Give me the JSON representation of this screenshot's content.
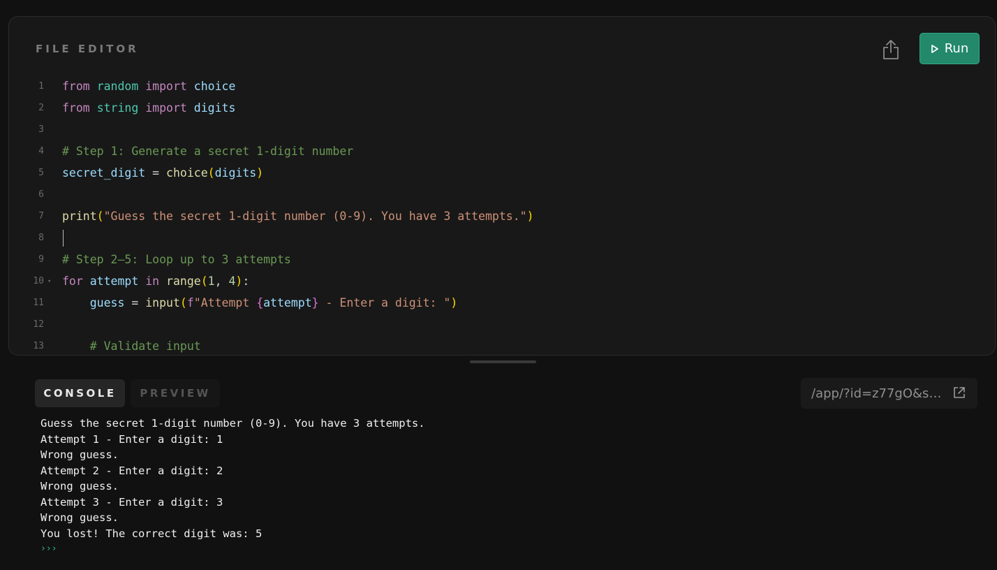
{
  "editor": {
    "title": "FILE EDITOR",
    "run_label": "Run",
    "lines": [
      {
        "n": "1"
      },
      {
        "n": "2"
      },
      {
        "n": "3"
      },
      {
        "n": "4"
      },
      {
        "n": "5"
      },
      {
        "n": "6"
      },
      {
        "n": "7"
      },
      {
        "n": "8"
      },
      {
        "n": "9"
      },
      {
        "n": "10"
      },
      {
        "n": "11"
      },
      {
        "n": "12"
      },
      {
        "n": "13"
      }
    ],
    "code": {
      "l1": {
        "kw1": "from",
        "mod": "random",
        "kw2": "import",
        "name": "choice"
      },
      "l2": {
        "kw1": "from",
        "mod": "string",
        "kw2": "import",
        "name": "digits"
      },
      "l4": {
        "comment": "# Step 1: Generate a secret 1-digit number"
      },
      "l5": {
        "var": "secret_digit",
        "eq": " = ",
        "fn": "choice",
        "open": "(",
        "arg": "digits",
        "close": ")"
      },
      "l7": {
        "fn": "print",
        "open": "(",
        "str": "\"Guess the secret 1-digit number (0-9). You have 3 attempts.\"",
        "close": ")"
      },
      "l9": {
        "comment": "# Step 2–5: Loop up to 3 attempts"
      },
      "l10": {
        "kw1": "for",
        "var": "attempt",
        "kw2": "in",
        "fn": "range",
        "open": "(",
        "n1": "1",
        "sep": ", ",
        "n2": "4",
        "close": ")",
        "colon": ":"
      },
      "l11": {
        "var": "guess",
        "eq": " = ",
        "fn": "input",
        "open": "(",
        "f": "f",
        "str1": "\"Attempt ",
        "lb": "{",
        "var2": "attempt",
        "rb": "}",
        "str2": " - Enter a digit: \"",
        "close": ")"
      },
      "l13": {
        "comment": "# Validate input"
      }
    }
  },
  "tabs": {
    "console": "CONSOLE",
    "preview": "PREVIEW"
  },
  "url": "/app/?id=z77gO&so...",
  "console": {
    "lines": [
      "Guess the secret 1-digit number (0-9). You have 3 attempts.",
      "Attempt 1 - Enter a digit: 1",
      "Wrong guess.",
      "Attempt 2 - Enter a digit: 2",
      "Wrong guess.",
      "Attempt 3 - Enter a digit: 3",
      "Wrong guess.",
      "You lost! The correct digit was: 5"
    ],
    "prompt": "›››"
  },
  "colors": {
    "run_button": "#23896a",
    "prompt": "#2fb890"
  }
}
